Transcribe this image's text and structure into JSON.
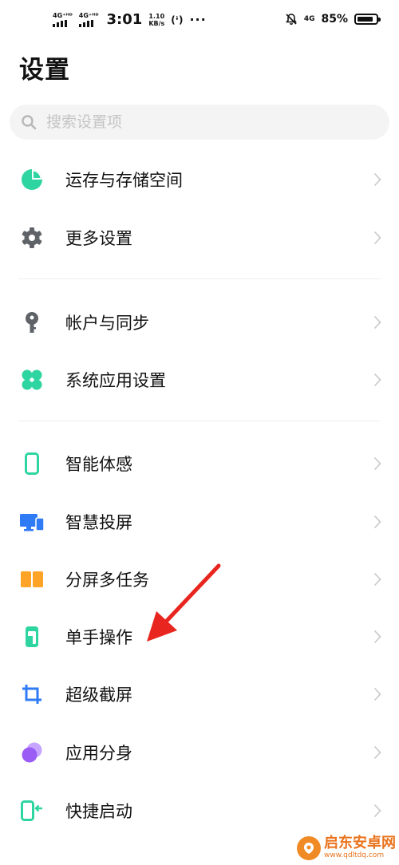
{
  "status_bar": {
    "sim1": "4G⁺ᴴᴰ",
    "sim2": "4G⁺ᴴᴰ",
    "time": "3:01",
    "speed_value": "1.10",
    "speed_unit": "KB/s",
    "hotspot": "(ᶤ)",
    "more": "···",
    "network": "4G",
    "battery_pct": "85%",
    "battery_level": 0.85
  },
  "page": {
    "title": "设置"
  },
  "search": {
    "placeholder": "搜索设置项"
  },
  "menu_items": [
    {
      "label": "运存与存储空间",
      "icon": "storage-pie-icon",
      "color": "#2fd5a0"
    },
    {
      "label": "更多设置",
      "icon": "gear-icon",
      "color": "#5f6368"
    },
    {
      "label": "帐户与同步",
      "icon": "key-icon",
      "color": "#5f6368"
    },
    {
      "label": "系统应用设置",
      "icon": "four-petal-icon",
      "color": "#2fd5a0"
    },
    {
      "label": "智能体感",
      "icon": "phone-outline-icon",
      "color": "#2fd5a0"
    },
    {
      "label": "智慧投屏",
      "icon": "screen-cast-icon",
      "color": "#2f7bf5"
    },
    {
      "label": "分屏多任务",
      "icon": "split-screen-icon",
      "color": "#ffa427"
    },
    {
      "label": "单手操作",
      "icon": "one-hand-icon",
      "color": "#2fd5a0"
    },
    {
      "label": "超级截屏",
      "icon": "crop-icon",
      "color": "#2f7bf5"
    },
    {
      "label": "应用分身",
      "icon": "clone-circles-icon",
      "color": "#9b5cf6"
    },
    {
      "label": "快捷启动",
      "icon": "quick-launch-icon",
      "color": "#2fd5a0"
    }
  ],
  "annotation": {
    "color": "#e8251e"
  },
  "watermark": {
    "main": "启东安卓网",
    "url": "www.qdltdq.com"
  }
}
